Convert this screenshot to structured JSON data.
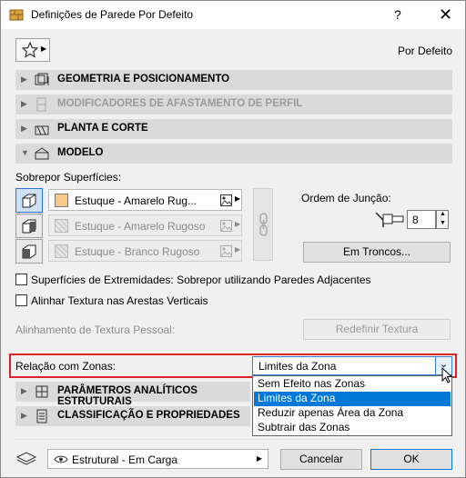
{
  "window": {
    "title": "Definições de Parede Por Defeito",
    "help": "?",
    "close": "✕"
  },
  "preset": {
    "label": "Por Defeito"
  },
  "sections": {
    "geometry": "GEOMETRIA E POSICIONAMENTO",
    "profile_modifiers": "MODIFICADORES DE AFASTAMENTO DE PERFIL",
    "floor_plan": "PLANTA E CORTE",
    "model": "MODELO",
    "structural": "PARÂMETROS ANALÍTICOS ESTRUTURAIS",
    "classification": "CLASSIFICAÇÃO E PROPRIEDADES"
  },
  "model": {
    "override_label": "Sobrepor Superfícies:",
    "surfaces": [
      {
        "label": "Estuque - Amarelo Rug...",
        "color": "#f5c987",
        "enabled": true
      },
      {
        "label": "Estuque - Amarelo Rugoso",
        "color": "#e8e8e8",
        "enabled": false
      },
      {
        "label": "Estuque - Branco Rugoso",
        "color": "#e8e8e8",
        "enabled": false
      }
    ],
    "junction_label": "Ordem de Junção:",
    "junction_value": "8",
    "log_button": "Em Troncos...",
    "edge_checkbox_label": "Superfícies de Extremidades: Sobrepor utilizando Paredes Adjacentes",
    "align_checkbox_label": "Alinhar Textura nas Arestas Verticais",
    "custom_texture_label": "Alinhamento de Textura Pessoal:",
    "reset_texture_button": "Redefinir Textura",
    "zone_label": "Relação com Zonas:",
    "zone_value": "Limites da Zona",
    "zone_options": [
      "Sem Efeito nas Zonas",
      "Limites da Zona",
      "Reduzir apenas Área da Zona",
      "Subtrair das Zonas"
    ],
    "zone_selected_index": 1
  },
  "footer": {
    "layer_value": "Estrutural - Em Carga",
    "cancel_label": "Cancelar",
    "ok_label": "OK"
  },
  "colors": {
    "accent": "#0078d7",
    "highlight_border": "#e0202a",
    "section_bg": "#dadada"
  }
}
